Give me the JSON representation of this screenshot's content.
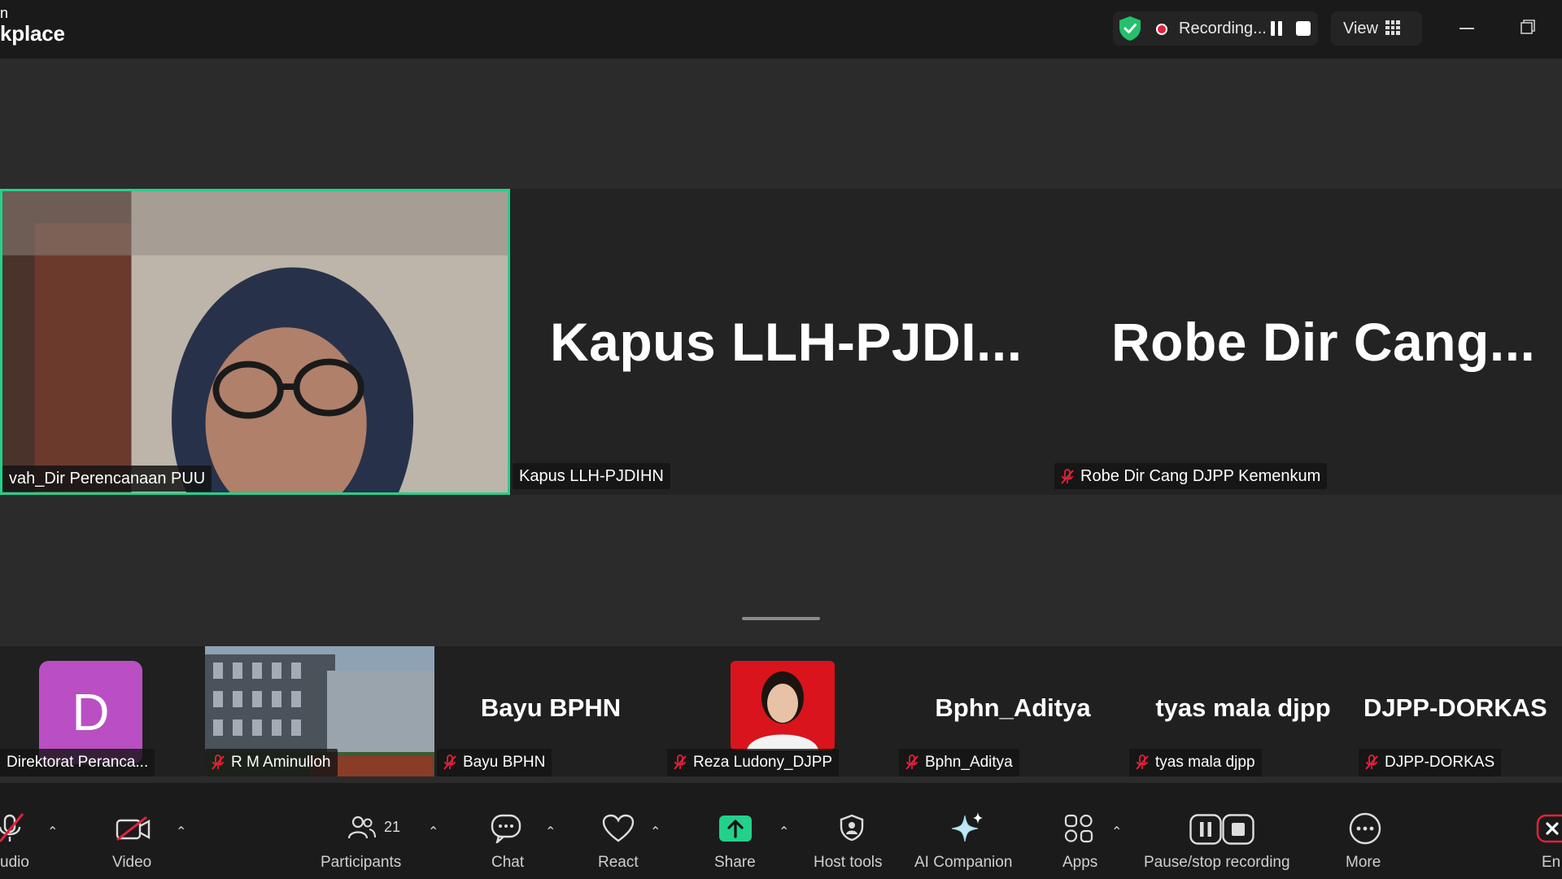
{
  "app": {
    "title_fragment_top": "n",
    "title_fragment": "kplace"
  },
  "recording": {
    "status": "Recording..."
  },
  "view": {
    "label": "View"
  },
  "stage": {
    "active_speaker": {
      "name": "vah_Dir Perencanaan PUU"
    },
    "tiles": [
      {
        "big_label": "Kapus  LLH-PJDI...",
        "name": "Kapus LLH-PJDIHN",
        "muted": false
      },
      {
        "big_label": "Robe  Dir  Cang...",
        "name": "Robe Dir Cang DJPP Kemenkum",
        "muted": true
      }
    ]
  },
  "thumbnails": [
    {
      "avatar_letter": "D",
      "name": "Direktorat Peranca...",
      "muted": false,
      "kind": "avatar"
    },
    {
      "name": "R M Aminulloh",
      "muted": true,
      "kind": "photo-building"
    },
    {
      "big_label": "Bayu BPHN",
      "name": "Bayu BPHN",
      "muted": true,
      "kind": "text"
    },
    {
      "name": "Reza Ludony_DJPP",
      "muted": true,
      "kind": "photo-person"
    },
    {
      "big_label": "Bphn_Aditya",
      "name": "Bphn_Aditya",
      "muted": true,
      "kind": "text"
    },
    {
      "big_label": "tyas mala djpp",
      "name": "tyas mala djpp",
      "muted": true,
      "kind": "text"
    },
    {
      "big_label": "DJPP-DORKAS",
      "name": "DJPP-DORKAS",
      "muted": true,
      "kind": "text"
    }
  ],
  "toolbar": {
    "audio_label": "udio",
    "video_label": "Video",
    "participants_label": "Participants",
    "participants_count": "21",
    "chat_label": "Chat",
    "react_label": "React",
    "share_label": "Share",
    "host_tools_label": "Host tools",
    "ai_companion_label": "AI Companion",
    "apps_label": "Apps",
    "pause_stop_label": "Pause/stop recording",
    "more_label": "More",
    "end_label": "En"
  },
  "colors": {
    "accent_green": "#23d18b",
    "recording_red": "#e5203a",
    "end_red": "#e5203a",
    "share_green": "#23d18b",
    "avatar_purple": "#b94fc2"
  }
}
